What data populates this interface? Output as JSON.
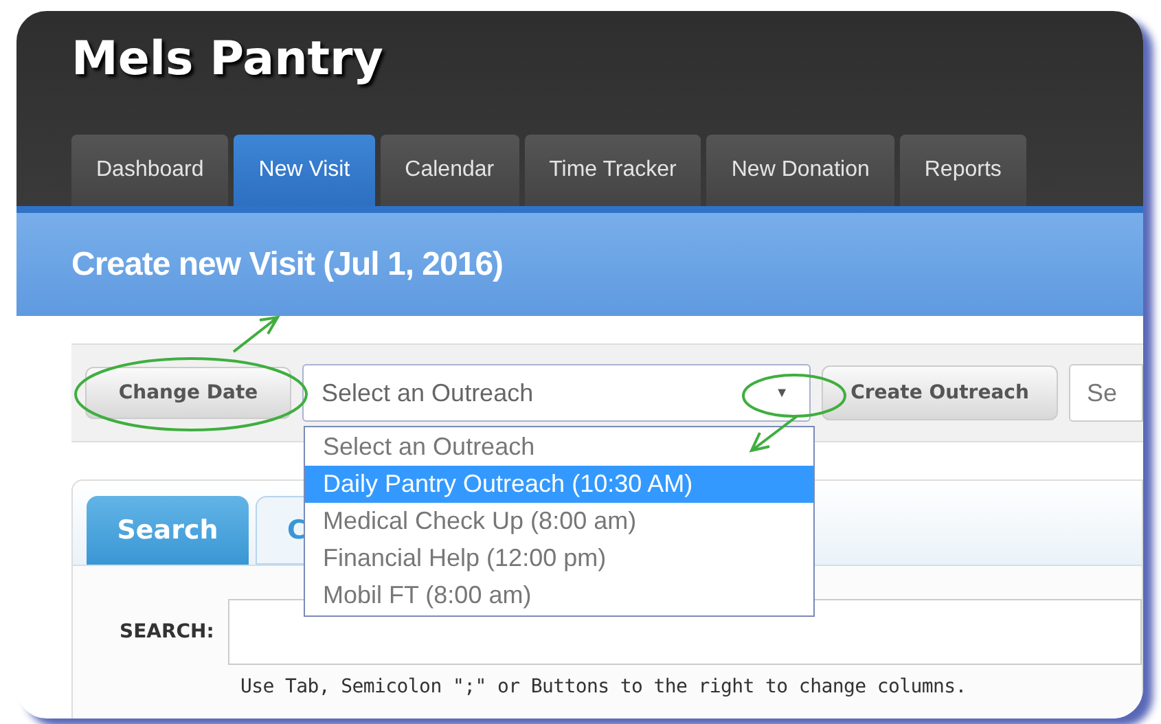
{
  "app_title": "Mels Pantry",
  "tabs": [
    {
      "label": "Dashboard",
      "selected": false
    },
    {
      "label": "New Visit",
      "selected": true
    },
    {
      "label": "Calendar",
      "selected": false
    },
    {
      "label": "Time Tracker",
      "selected": false
    },
    {
      "label": "New Donation",
      "selected": false
    },
    {
      "label": "Reports",
      "selected": false
    }
  ],
  "page_heading": "Create new Visit (Jul 1, 2016)",
  "toolbar": {
    "change_date_button": "Change Date",
    "outreach_select": {
      "value": "Select an Outreach",
      "arrow": "▼",
      "expanded": true
    },
    "create_outreach_button": "Create Outreach",
    "search_field": {
      "placeholder": "Se"
    }
  },
  "outreach_options": [
    {
      "label": "Select an Outreach",
      "selected": false
    },
    {
      "label": "Daily Pantry Outreach (10:30 AM)",
      "selected": true
    },
    {
      "label": "Medical Check Up (8:00 am)",
      "selected": false
    },
    {
      "label": "Financial Help (12:00 pm)",
      "selected": false
    },
    {
      "label": "Mobil FT (8:00 am)",
      "selected": false
    }
  ],
  "panel_tabs": [
    {
      "label": "Search",
      "selected": true
    },
    {
      "label": "C",
      "selected": false
    }
  ],
  "search": {
    "label": "SEARCH:",
    "hint": "Use Tab, Semicolon \";\" or Buttons to the right to change columns."
  }
}
